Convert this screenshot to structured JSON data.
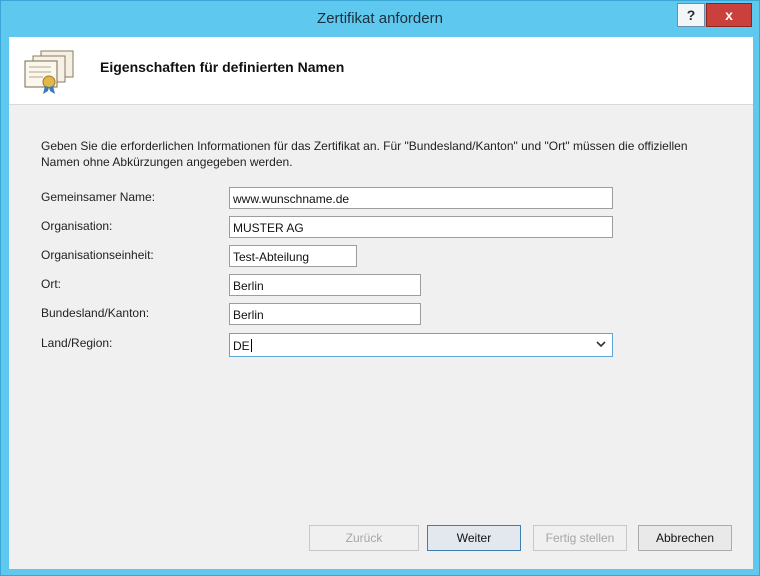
{
  "window": {
    "title": "Zertifikat anfordern",
    "help_label": "?",
    "close_label": "x"
  },
  "header": {
    "title": "Eigenschaften für definierten Namen",
    "icon": "certificate-icon"
  },
  "intro_text": "Geben Sie die erforderlichen Informationen für das Zertifikat an. Für \"Bundesland/Kanton\" und \"Ort\" müssen die offiziellen Namen ohne Abkürzungen angegeben werden.",
  "fields": {
    "common_name": {
      "label": "Gemeinsamer Name:",
      "value": "www.wunschname.de"
    },
    "organization": {
      "label": "Organisation:",
      "value": "MUSTER AG"
    },
    "org_unit": {
      "label": "Organisationseinheit:",
      "value": "Test-Abteilung"
    },
    "city": {
      "label": "Ort:",
      "value": "Berlin"
    },
    "state": {
      "label": "Bundesland/Kanton:",
      "value": "Berlin"
    },
    "country": {
      "label": "Land/Region:",
      "value": "DE"
    }
  },
  "buttons": {
    "back": "Zurück",
    "next": "Weiter",
    "finish": "Fertig stellen",
    "cancel": "Abbrechen"
  },
  "colors": {
    "title_bar": "#5ec8ee",
    "close_button": "#c9403c",
    "dialog_background": "#f0f0f0"
  }
}
